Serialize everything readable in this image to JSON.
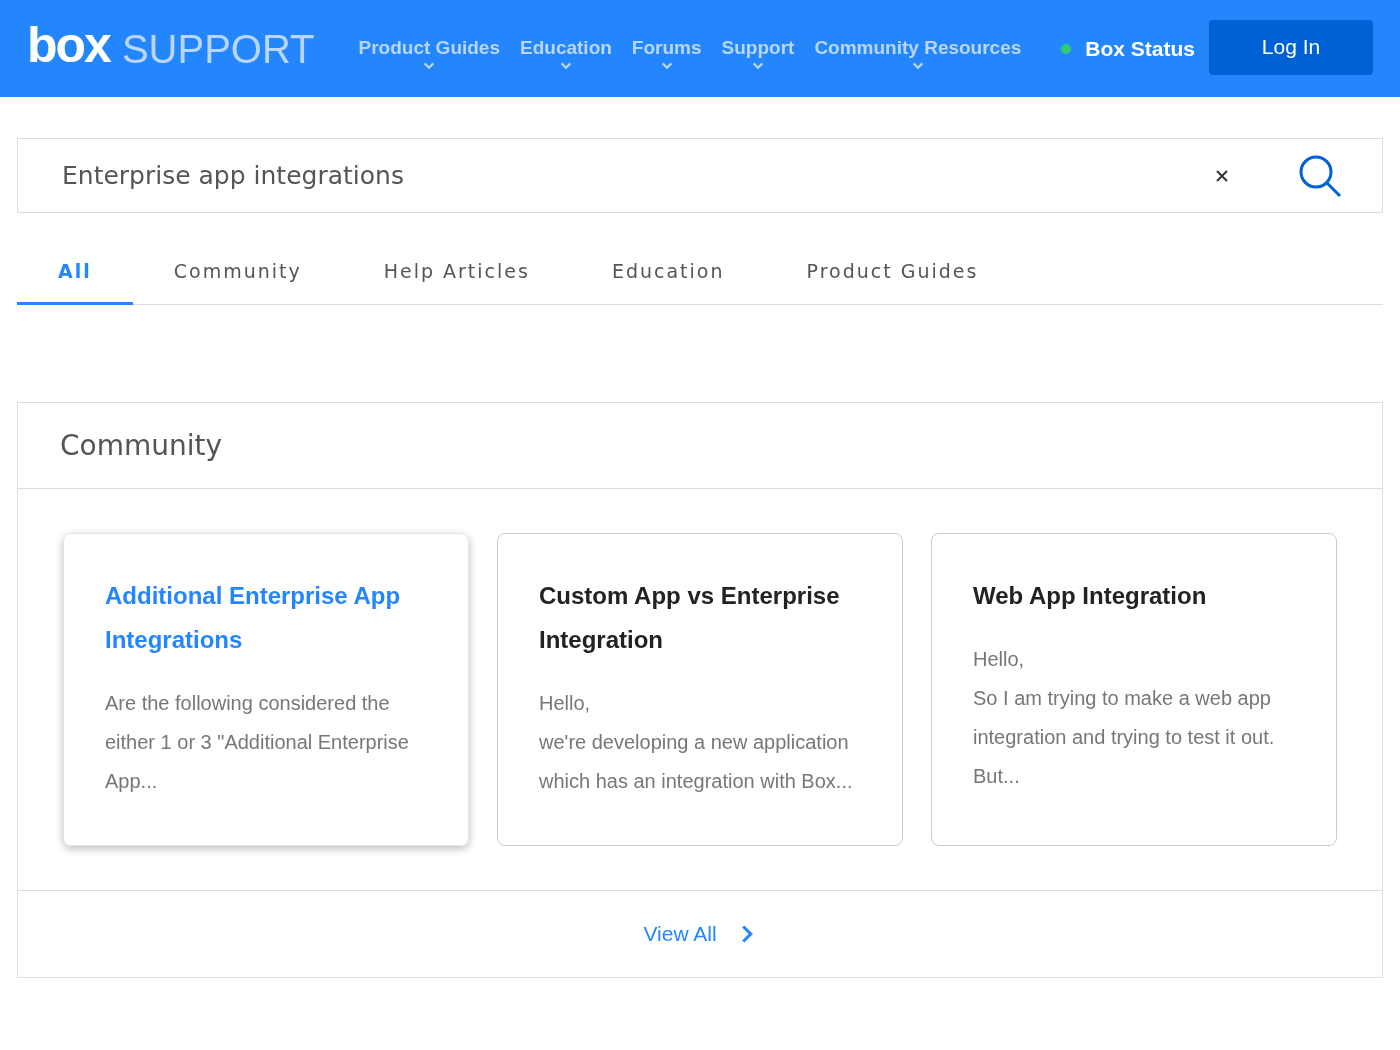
{
  "header": {
    "logo": "box",
    "product": "SUPPORT",
    "nav": [
      {
        "label": "Product Guides"
      },
      {
        "label": "Education"
      },
      {
        "label": "Forums"
      },
      {
        "label": "Support"
      },
      {
        "label": "Community Resources"
      }
    ],
    "status": {
      "label": "Box Status",
      "color": "#2ecc71"
    },
    "login": "Log In"
  },
  "search": {
    "value": "Enterprise app integrations"
  },
  "tabs": [
    {
      "label": "All",
      "selected": true
    },
    {
      "label": "Community",
      "selected": false
    },
    {
      "label": "Help Articles",
      "selected": false
    },
    {
      "label": "Education",
      "selected": false
    },
    {
      "label": "Product Guides",
      "selected": false
    }
  ],
  "section": {
    "title": "Community",
    "cards": [
      {
        "title": "Additional Enterprise App Integrations",
        "excerpt": [
          "Are the following considered the either 1 or 3 \"Additional Enterprise App..."
        ],
        "highlighted": true
      },
      {
        "title": "Custom App vs Enterprise Integration",
        "excerpt": [
          "Hello,",
          "we're developing a new application which has an integration with Box..."
        ],
        "highlighted": false
      },
      {
        "title": "Web App Integration",
        "excerpt": [
          "Hello,",
          "So I am trying to make a web app integration and trying to test it out. But..."
        ],
        "highlighted": false
      }
    ],
    "view_all": "View All"
  }
}
